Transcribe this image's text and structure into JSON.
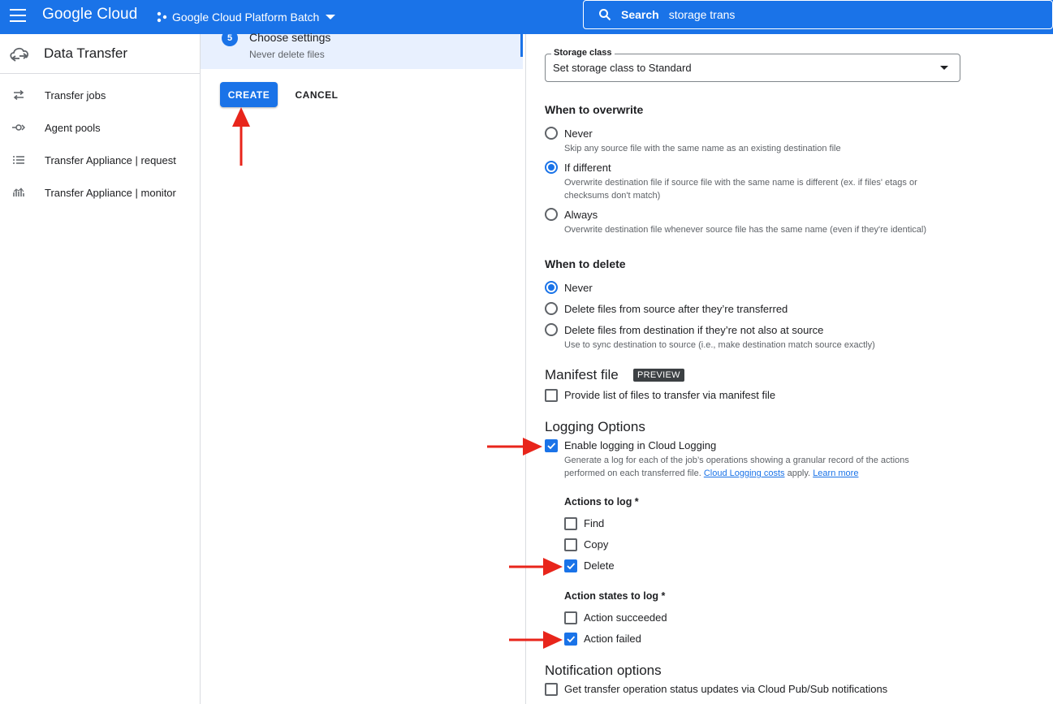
{
  "topbar": {
    "logo": "Google Cloud",
    "project": "Google Cloud Platform Batch",
    "search_label": "Search",
    "search_value": "storage trans"
  },
  "sidebar": {
    "title": "Data Transfer",
    "items": [
      {
        "label": "Transfer jobs",
        "icon": "swap-arrows-icon"
      },
      {
        "label": "Agent pools",
        "icon": "agent-icon"
      },
      {
        "label": "Transfer Appliance | request",
        "icon": "list-icon"
      },
      {
        "label": "Transfer Appliance | monitor",
        "icon": "chart-icon"
      }
    ]
  },
  "step": {
    "number": "5",
    "title": "Choose settings",
    "subtitle": "Never delete files"
  },
  "actions": {
    "create": "CREATE",
    "cancel": "CANCEL"
  },
  "storage_class": {
    "label": "Storage class",
    "value": "Set storage class to Standard"
  },
  "overwrite": {
    "title": "When to overwrite",
    "options": [
      {
        "label": "Never",
        "desc": "Skip any source file with the same name as an existing destination file",
        "selected": false
      },
      {
        "label": "If different",
        "desc1": "Overwrite destination file if source file with the same name is different (ex. if files' etags or",
        "desc2": "checksums don't match)",
        "selected": true
      },
      {
        "label": "Always",
        "desc": "Overwrite destination file whenever source file has the same name (even if they're identical)",
        "selected": false
      }
    ]
  },
  "delete": {
    "title": "When to delete",
    "options": [
      {
        "label": "Never",
        "selected": true
      },
      {
        "label": "Delete files from source after they’re transferred",
        "selected": false
      },
      {
        "label": "Delete files from destination if they’re not also at source",
        "desc": "Use to sync destination to source (i.e., make destination match source exactly)",
        "selected": false
      }
    ]
  },
  "manifest": {
    "title": "Manifest file",
    "badge": "PREVIEW",
    "checkbox_label": "Provide list of files to transfer via manifest file",
    "checked": false
  },
  "logging": {
    "title": "Logging Options",
    "enable_label": "Enable logging in Cloud Logging",
    "enable_checked": true,
    "desc1": "Generate a log for each of the job’s operations showing a granular record of the actions",
    "desc2_prefix": "performed on each transferred file.",
    "costs_link": "Cloud Logging costs",
    "desc2_mid": "apply.",
    "learn_more": "Learn more",
    "actions_title": "Actions to log *",
    "actions": [
      {
        "label": "Find",
        "checked": false
      },
      {
        "label": "Copy",
        "checked": false
      },
      {
        "label": "Delete",
        "checked": true
      }
    ],
    "states_title": "Action states to log *",
    "states": [
      {
        "label": "Action succeeded",
        "checked": false
      },
      {
        "label": "Action failed",
        "checked": true
      }
    ]
  },
  "notification": {
    "title": "Notification options",
    "checkbox_label": "Get transfer operation status updates via Cloud Pub/Sub notifications",
    "checked": false
  },
  "colors": {
    "primary": "#1a73e8",
    "annotation_arrow": "#e8251b"
  }
}
